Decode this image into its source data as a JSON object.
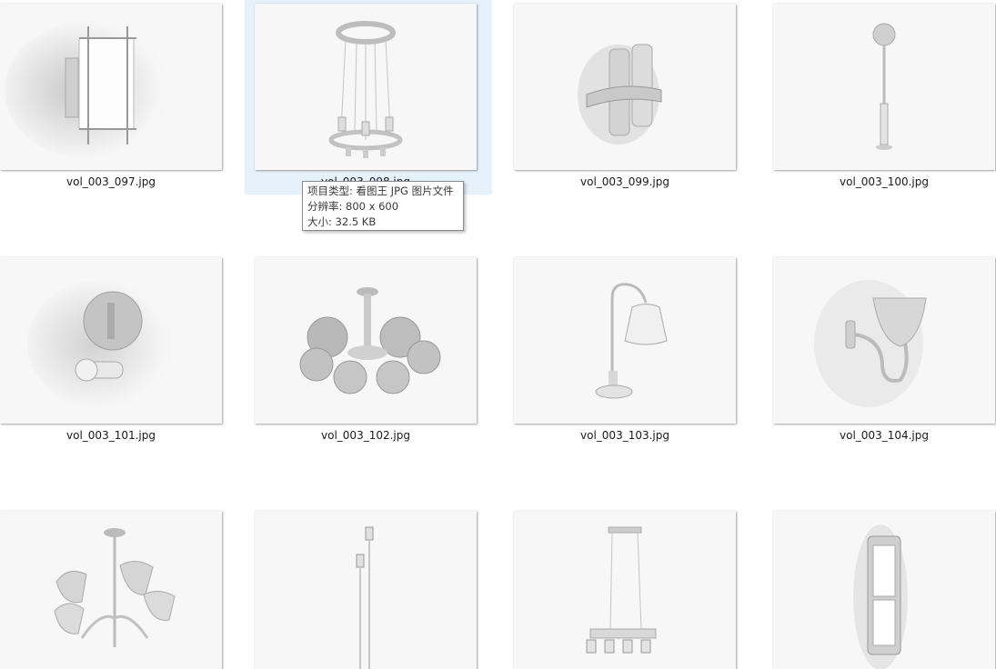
{
  "files": [
    {
      "name": "vol_003_097.jpg",
      "icon": "wall-sconce-cage-thumbnail"
    },
    {
      "name": "vol_003_098.jpg",
      "icon": "ring-chandelier-thumbnail",
      "selected": true
    },
    {
      "name": "vol_003_099.jpg",
      "icon": "wall-candle-sconce-thumbnail"
    },
    {
      "name": "vol_003_100.jpg",
      "icon": "floor-lamp-globe-thumbnail"
    },
    {
      "name": "vol_003_101.jpg",
      "icon": "wall-globe-lamp-thumbnail"
    },
    {
      "name": "vol_003_102.jpg",
      "icon": "globe-chandelier-thumbnail"
    },
    {
      "name": "vol_003_103.jpg",
      "icon": "table-lamp-thumbnail"
    },
    {
      "name": "vol_003_104.jpg",
      "icon": "wall-bell-lamp-thumbnail"
    },
    {
      "name": "",
      "icon": "five-arm-chandelier-thumbnail"
    },
    {
      "name": "",
      "icon": "floor-pole-lamp-thumbnail"
    },
    {
      "name": "",
      "icon": "pendant-bar-lamp-thumbnail"
    },
    {
      "name": "",
      "icon": "wall-panel-light-thumbnail"
    }
  ],
  "tooltip": {
    "type_line": "项目类型: 看图王 JPG 图片文件",
    "resolution_line": "分辨率: 800 x 600",
    "size_line": "大小: 32.5 KB"
  },
  "colors": {
    "selection": "#e5f1fb",
    "thumbnail_bg": "#f6f6f6",
    "text": "#1a1a1a"
  }
}
